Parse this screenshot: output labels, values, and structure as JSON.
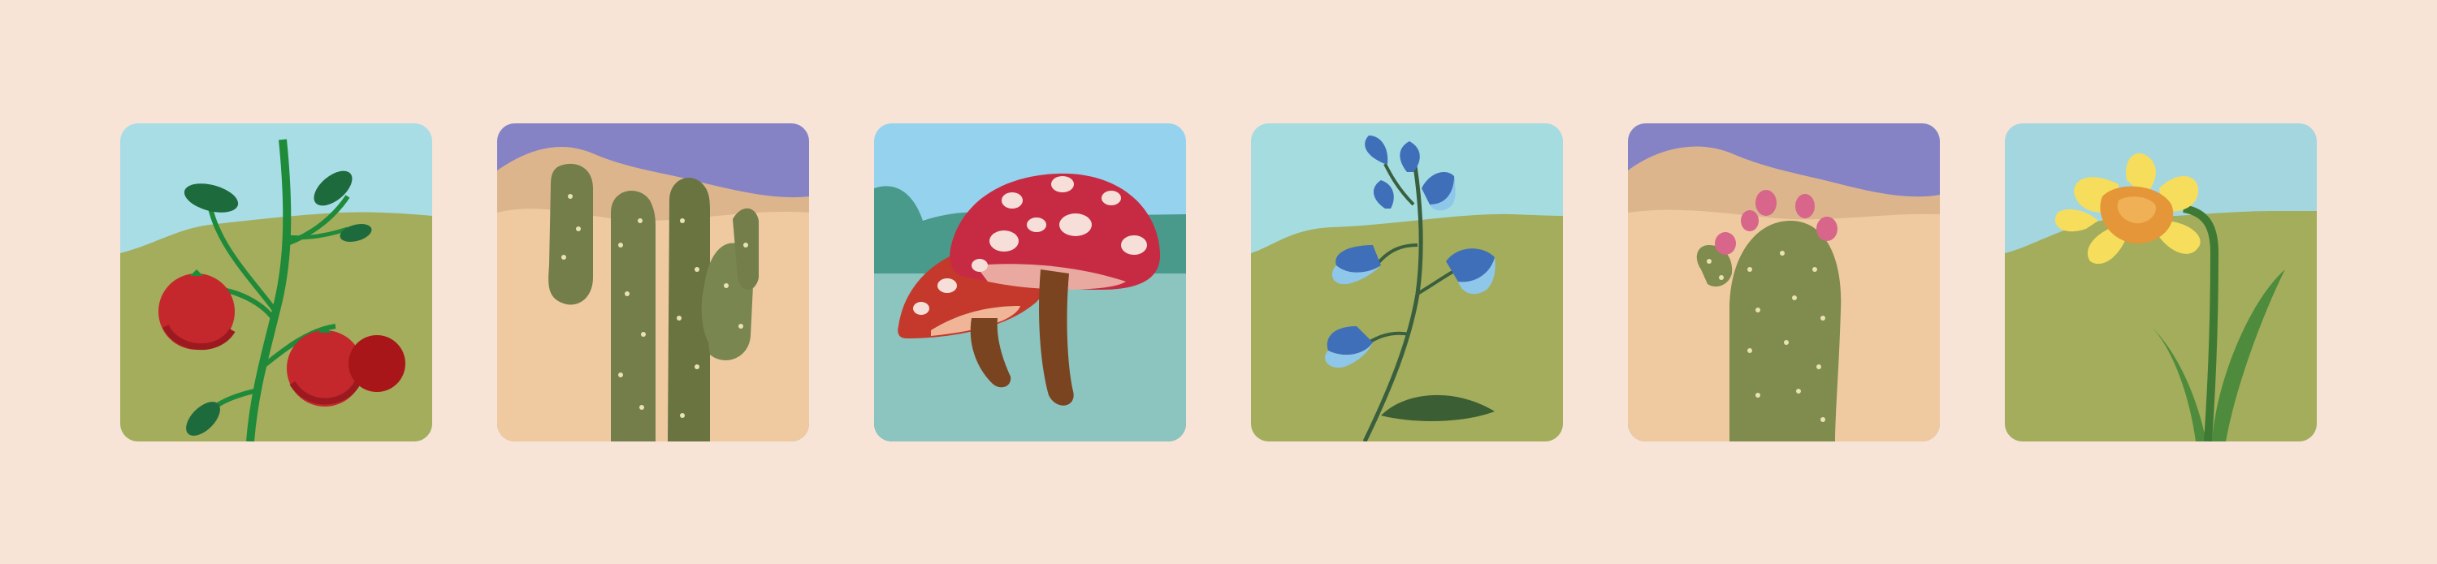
{
  "illustrations": [
    {
      "icon": "tomato-plant-icon",
      "sky": "#a8dde6",
      "ground": "#a3ad5b"
    },
    {
      "icon": "cactus-icon",
      "sky": "#8582c6",
      "ground": "#efcaa0"
    },
    {
      "icon": "mushroom-icon",
      "sky": "#95d2ee",
      "ground": "#8cc4bf"
    },
    {
      "icon": "bellflower-icon",
      "sky": "#a4dce0",
      "ground": "#a3ad5b"
    },
    {
      "icon": "prickly-pear-icon",
      "sky": "#8582c6",
      "ground": "#efcaa0"
    },
    {
      "icon": "daffodil-icon",
      "sky": "#a4d6df",
      "ground": "#a3ad5b"
    }
  ],
  "colors": {
    "page_background": "#f7e4d6"
  }
}
